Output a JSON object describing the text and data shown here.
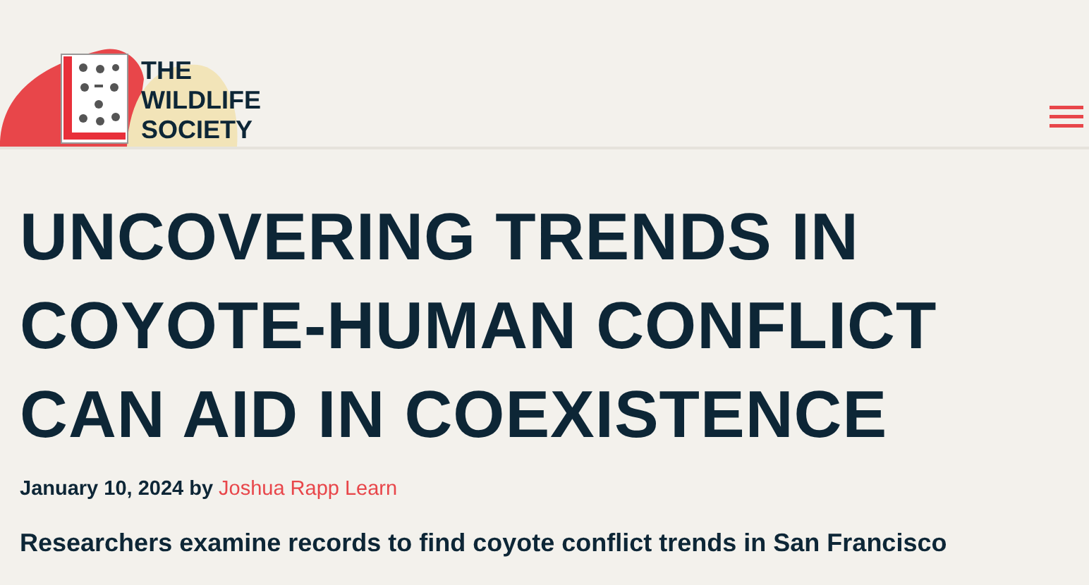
{
  "site": {
    "logo_lines": [
      "THE",
      "WILDLIFE",
      "SOCIETY"
    ]
  },
  "article": {
    "title": "UNCOVERING TRENDS IN COYOTE-HUMAN CONFLICT CAN AID IN COEXISTENCE",
    "date": "January 10, 2024",
    "by": "by",
    "author": "Joshua Rapp Learn",
    "subtitle": "Researchers examine records to find coyote conflict trends in San Francisco"
  }
}
